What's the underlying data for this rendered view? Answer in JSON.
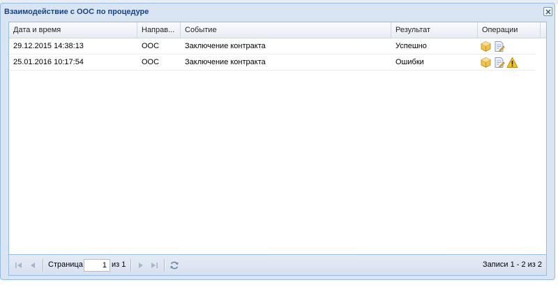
{
  "window": {
    "title": "Взаимодействие с ООС по процедуре"
  },
  "grid": {
    "columns": [
      "Дата и время",
      "Направ...",
      "Событие",
      "Результат",
      "Операции"
    ],
    "rows": [
      {
        "datetime": "29.12.2015 14:38:13",
        "direction": "ООС",
        "event": "Заключение контракта",
        "result": "Успешно",
        "ops": [
          "package-icon",
          "document-edit-icon"
        ]
      },
      {
        "datetime": "25.01.2016 10:17:54",
        "direction": "ООС",
        "event": "Заключение контракта",
        "result": "Ошибки",
        "ops": [
          "package-icon",
          "document-edit-icon",
          "warning-icon"
        ]
      }
    ]
  },
  "paging": {
    "page_label": "Страница",
    "page_value": "1",
    "of_label": "из 1",
    "records_info": "Записи 1 - 2 из 2"
  },
  "colors": {
    "header_title": "#15428b",
    "window_bg": "#d9e5f3",
    "border": "#99bbe8"
  }
}
